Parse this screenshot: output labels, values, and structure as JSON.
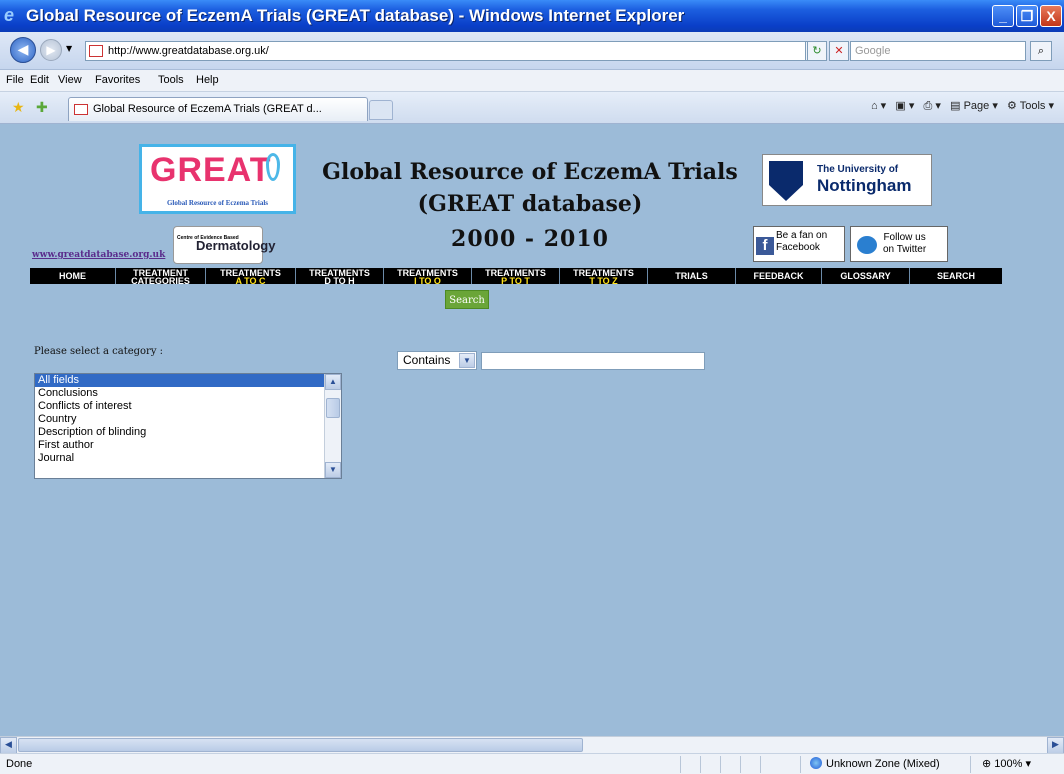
{
  "window": {
    "title": "Global Resource of EczemA Trials (GREAT database) - Windows Internet Explorer",
    "minimize": "_",
    "maximize": "❐",
    "close": "X"
  },
  "address_bar": {
    "url": "http://www.greatdatabase.org.uk/",
    "search_placeholder": "Google"
  },
  "menu": {
    "items": [
      "File",
      "Edit",
      "View",
      "Favorites",
      "Tools",
      "Help"
    ]
  },
  "tabs": {
    "active_label": "Global Resource of EczemA Trials (GREAT d..."
  },
  "command_bar": {
    "page_label": "Page",
    "tools_label": "Tools"
  },
  "header": {
    "logo_text": "GREAT",
    "logo_subtext": "Global Resource of Eczema Trials",
    "title_line1": "Global Resource of EczemA Trials",
    "title_line2": "(GREAT database)",
    "years": "2000 - 2010",
    "university_line1": "The University of",
    "university_line2": "Nottingham",
    "cebd_small": "Centre of Evidence Based",
    "cebd_big": "Dermatology",
    "site_link": "www.greatdatabase.org.uk",
    "facebook_line1": "Be a fan on",
    "facebook_line2": "Facebook",
    "twitter_line1": "Follow us",
    "twitter_line2": "on Twitter"
  },
  "nav": {
    "home": "HOME",
    "treatment_categories": [
      "TREATMENT",
      "CATEGORIES"
    ],
    "treatments_a_c": [
      "TREATMENTS",
      "A TO C"
    ],
    "treatments_d_h": [
      "TREATMENTS",
      "D TO H"
    ],
    "treatments_i_o": [
      "TREATMENTS",
      "I TO O"
    ],
    "treatments_p_t": [
      "TREATMENTS",
      "P TO T"
    ],
    "treatments_t_z": [
      "TREATMENTS",
      "T TO Z"
    ],
    "trials": "TRIALS",
    "feedback": "FEEDBACK",
    "glossary": "GLOSSARY",
    "search": "SEARCH"
  },
  "search_form": {
    "search_button": "Search",
    "category_label": "Please select a category :",
    "categories": [
      "All fields",
      "Conclusions",
      "Conflicts of interest",
      "Country",
      "Description of blinding",
      "First author",
      "Journal"
    ],
    "selected_category": "All fields",
    "match_mode": "Contains",
    "query": ""
  },
  "status_bar": {
    "status": "Done",
    "zone": "Unknown Zone (Mixed)",
    "zoom": "100%"
  }
}
